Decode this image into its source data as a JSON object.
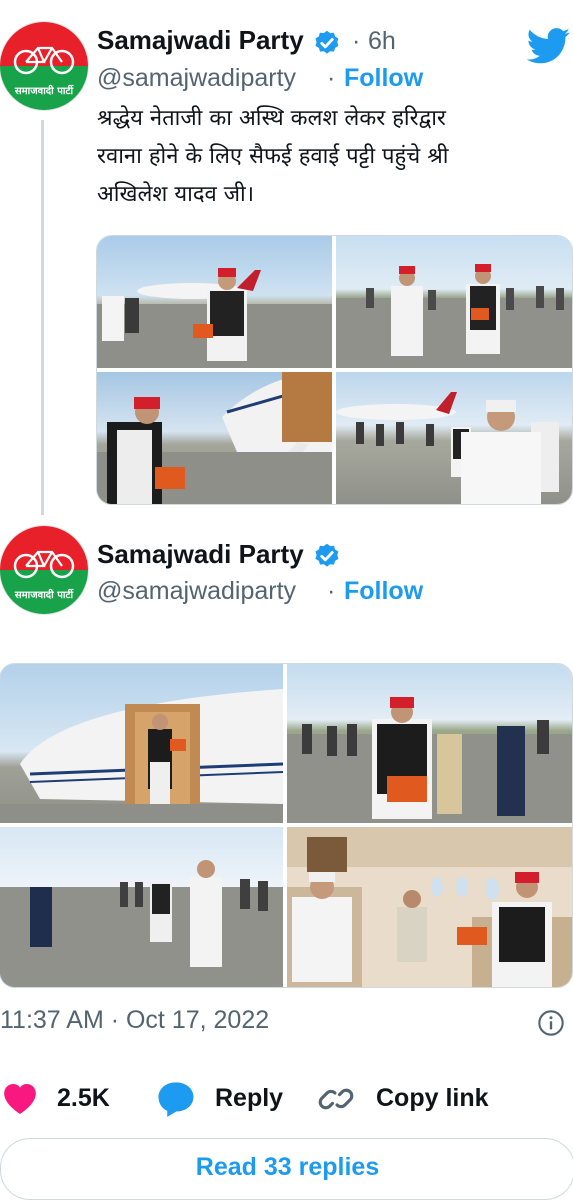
{
  "tweet1": {
    "name": "Samajwadi Party",
    "time": "6h",
    "handle": "@samajwadiparty",
    "follow": "Follow",
    "avatar_label": "समाजवादी पार्टी",
    "text_lines": [
      "श्रद्धेय नेताजी का अस्थि कलश लेकर हरिद्वार",
      "रवाना होने के लिए सैफई हवाई पट्टी पहुंचे श्री",
      "अखिलेश यादव जी।"
    ]
  },
  "tweet2": {
    "name": "Samajwadi Party",
    "handle": "@samajwadiparty",
    "follow": "Follow",
    "avatar_label": "समाजवादी पार्टी",
    "timestamp": "11:37 AM · Oct 17, 2022"
  },
  "actions": {
    "likes": "2.5K",
    "reply": "Reply",
    "copy_link": "Copy link"
  },
  "read_replies": "Read 33 replies",
  "separator": "·",
  "icons": [
    "twitter-bird-icon",
    "verified-badge-icon",
    "info-icon",
    "heart-icon",
    "reply-icon",
    "link-icon"
  ],
  "colors": {
    "accent": "#1d9bf0",
    "like": "#f91880",
    "party_red": "#e8202a",
    "party_green": "#18a34a"
  }
}
